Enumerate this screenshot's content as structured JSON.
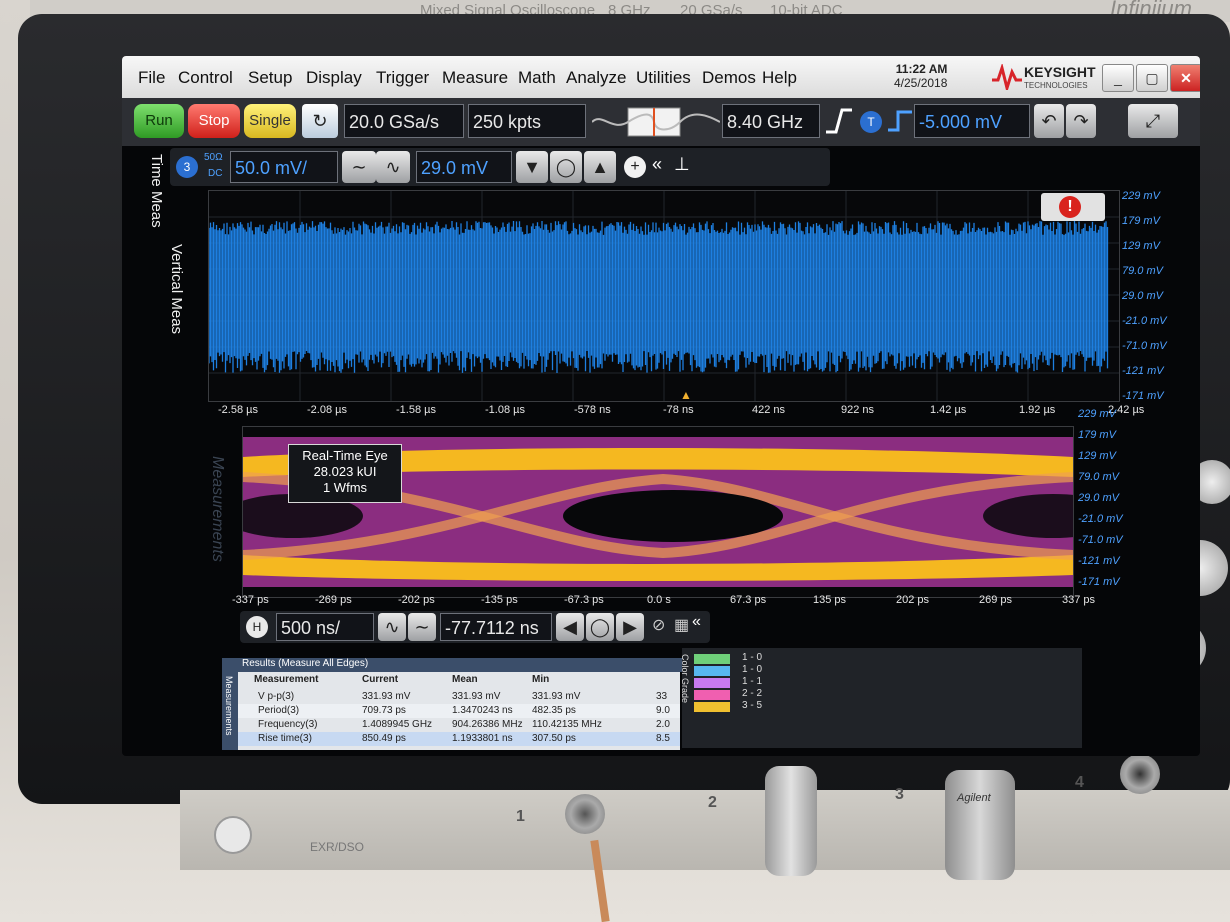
{
  "instrument": {
    "top_text_1": "Mixed Signal Oscilloscope",
    "top_text_2": "8 GHz",
    "top_text_3": "20 GSa/s",
    "top_text_4": "10-bit ADC",
    "top_brand": "Infiniium"
  },
  "menu": [
    "File",
    "Control",
    "Setup",
    "Display",
    "Trigger",
    "Measure",
    "Math",
    "Analyze",
    "Utilities",
    "Demos",
    "Help"
  ],
  "clock": {
    "time": "11:22 AM",
    "date": "4/25/2018"
  },
  "brand": {
    "name": "KEYSIGHT",
    "sub": "TECHNOLOGIES"
  },
  "toolbar": {
    "run": "Run",
    "stop": "Stop",
    "single": "Single",
    "sample_rate": "20.0 GSa/s",
    "memory": "250 kpts",
    "bandwidth": "8.40 GHz",
    "trigger_level": "-5.000 mV",
    "trigger_chip": "T"
  },
  "side_tabs": {
    "time": "Time Meas",
    "vertical": "Vertical Meas",
    "measurements": "Measurements"
  },
  "channel": {
    "number": "3",
    "coupling_1": "50Ω",
    "coupling_2": "DC",
    "scale": "50.0 mV/",
    "offset": "29.0 mV"
  },
  "upper_plot": {
    "right_axis": [
      "229 mV",
      "179 mV",
      "129 mV",
      "79.0 mV",
      "29.0 mV",
      "-21.0 mV",
      "-71.0 mV",
      "-121 mV",
      "-171 mV"
    ],
    "bottom_axis": [
      "-2.58 µs",
      "-2.08 µs",
      "-1.58 µs",
      "-1.08 µs",
      "-578 ns",
      "-78 ns",
      "422 ns",
      "922 ns",
      "1.42 µs",
      "1.92 µs",
      "2.42 µs"
    ],
    "waveform_color": "#1e7fe0"
  },
  "lower_plot": {
    "right_axis": [
      "229 mV",
      "179 mV",
      "129 mV",
      "79.0 mV",
      "29.0 mV",
      "-21.0 mV",
      "-71.0 mV",
      "-121 mV",
      "-171 mV"
    ],
    "bottom_axis": [
      "-337 ps",
      "-269 ps",
      "-202 ps",
      "-135 ps",
      "-67.3 ps",
      "0.0 s",
      "67.3 ps",
      "135 ps",
      "202 ps",
      "269 ps",
      "337 ps"
    ],
    "eye_label": {
      "line1": "Real-Time Eye",
      "line2": "28.023 kUI",
      "line3": "1 Wfms"
    }
  },
  "horizontal": {
    "chip": "H",
    "scale": "500 ns/",
    "position": "-77.7112 ns"
  },
  "results": {
    "title": "Results  (Measure All Edges)",
    "side_label": "Measurements",
    "columns": [
      "Measurement",
      "Current",
      "Mean",
      "Min"
    ],
    "rows": [
      {
        "name": "V p-p(3)",
        "current": "331.93 mV",
        "mean": "331.93 mV",
        "min": "331.93 mV",
        "extra": "33"
      },
      {
        "name": "Period(3)",
        "current": "709.73 ps",
        "mean": "1.3470243 ns",
        "min": "482.35 ps",
        "extra": "9.0"
      },
      {
        "name": "Frequency(3)",
        "current": "1.4089945 GHz",
        "mean": "904.26386 MHz",
        "min": "110.42135 MHz",
        "extra": "2.0"
      },
      {
        "name": "Rise time(3)",
        "current": "850.49 ps",
        "mean": "1.1933801 ns",
        "min": "307.50 ps",
        "extra": "8.5"
      }
    ]
  },
  "color_grade": {
    "title": "Color Grade",
    "items": [
      {
        "label": "1 - 0",
        "color": "#6fd07a"
      },
      {
        "label": "1 - 0",
        "color": "#57b7f0"
      },
      {
        "label": "1 - 1",
        "color": "#c77af0"
      },
      {
        "label": "2 - 2",
        "color": "#f05fb0"
      },
      {
        "label": "3 - 5",
        "color": "#f0c030"
      }
    ]
  },
  "front_panel": {
    "ch1": "1",
    "ch2": "2",
    "ch3": "3",
    "ch4": "4",
    "probe_brand": "Agilent",
    "model": "EXR/DSO"
  }
}
